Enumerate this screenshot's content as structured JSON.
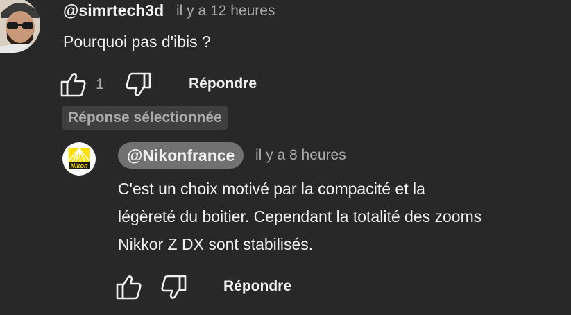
{
  "comment": {
    "author": "@simrtech3d",
    "time": "il y a 12 heures",
    "text": "Pourquoi pas d'ibis ?",
    "like_count": "1",
    "reply_label": "Répondre",
    "avatar_icon": "user-avatar-icon",
    "like_icon": "thumbs-up-icon",
    "dislike_icon": "thumbs-down-icon"
  },
  "selected_badge": "Réponse sélectionnée",
  "reply": {
    "author": "@Nikonfrance",
    "time": "il y a 8 heures",
    "text_lines": [
      "C'est un choix motivé par la compacité et la",
      "légèreté du boitier. Cependant la totalité des zooms",
      "Nikkor Z DX sont stabilisés."
    ],
    "reply_label": "Répondre",
    "logo_text": "Nikon",
    "avatar_icon": "nikon-logo-icon",
    "like_icon": "thumbs-up-icon",
    "dislike_icon": "thumbs-down-icon"
  },
  "colors": {
    "background": "#282828",
    "text": "#f1f1f1",
    "muted": "#aaaaaa",
    "badge_bg": "#3f3f3f",
    "creator_chip_bg": "#717171",
    "nikon_yellow": "#ffe100"
  }
}
